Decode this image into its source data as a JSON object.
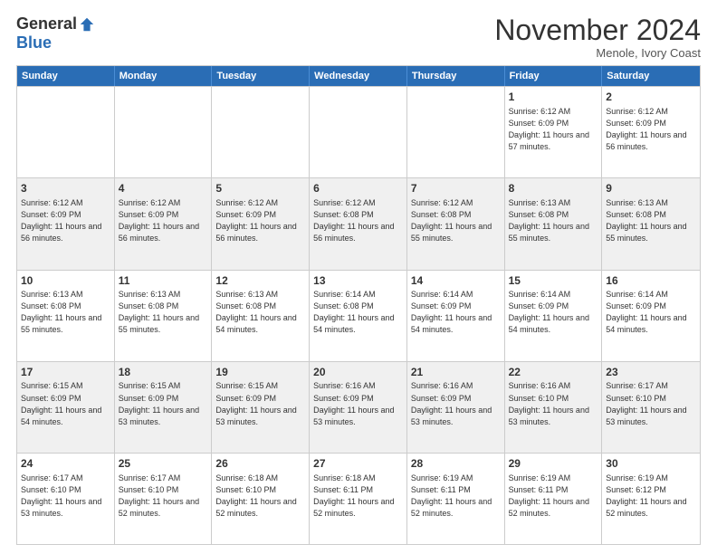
{
  "logo": {
    "general": "General",
    "blue": "Blue"
  },
  "header": {
    "month": "November 2024",
    "location": "Menole, Ivory Coast"
  },
  "days": [
    "Sunday",
    "Monday",
    "Tuesday",
    "Wednesday",
    "Thursday",
    "Friday",
    "Saturday"
  ],
  "weeks": [
    [
      {
        "day": "",
        "text": ""
      },
      {
        "day": "",
        "text": ""
      },
      {
        "day": "",
        "text": ""
      },
      {
        "day": "",
        "text": ""
      },
      {
        "day": "",
        "text": ""
      },
      {
        "day": "1",
        "text": "Sunrise: 6:12 AM\nSunset: 6:09 PM\nDaylight: 11 hours and 57 minutes."
      },
      {
        "day": "2",
        "text": "Sunrise: 6:12 AM\nSunset: 6:09 PM\nDaylight: 11 hours and 56 minutes."
      }
    ],
    [
      {
        "day": "3",
        "text": "Sunrise: 6:12 AM\nSunset: 6:09 PM\nDaylight: 11 hours and 56 minutes."
      },
      {
        "day": "4",
        "text": "Sunrise: 6:12 AM\nSunset: 6:09 PM\nDaylight: 11 hours and 56 minutes."
      },
      {
        "day": "5",
        "text": "Sunrise: 6:12 AM\nSunset: 6:09 PM\nDaylight: 11 hours and 56 minutes."
      },
      {
        "day": "6",
        "text": "Sunrise: 6:12 AM\nSunset: 6:08 PM\nDaylight: 11 hours and 56 minutes."
      },
      {
        "day": "7",
        "text": "Sunrise: 6:12 AM\nSunset: 6:08 PM\nDaylight: 11 hours and 55 minutes."
      },
      {
        "day": "8",
        "text": "Sunrise: 6:13 AM\nSunset: 6:08 PM\nDaylight: 11 hours and 55 minutes."
      },
      {
        "day": "9",
        "text": "Sunrise: 6:13 AM\nSunset: 6:08 PM\nDaylight: 11 hours and 55 minutes."
      }
    ],
    [
      {
        "day": "10",
        "text": "Sunrise: 6:13 AM\nSunset: 6:08 PM\nDaylight: 11 hours and 55 minutes."
      },
      {
        "day": "11",
        "text": "Sunrise: 6:13 AM\nSunset: 6:08 PM\nDaylight: 11 hours and 55 minutes."
      },
      {
        "day": "12",
        "text": "Sunrise: 6:13 AM\nSunset: 6:08 PM\nDaylight: 11 hours and 54 minutes."
      },
      {
        "day": "13",
        "text": "Sunrise: 6:14 AM\nSunset: 6:08 PM\nDaylight: 11 hours and 54 minutes."
      },
      {
        "day": "14",
        "text": "Sunrise: 6:14 AM\nSunset: 6:09 PM\nDaylight: 11 hours and 54 minutes."
      },
      {
        "day": "15",
        "text": "Sunrise: 6:14 AM\nSunset: 6:09 PM\nDaylight: 11 hours and 54 minutes."
      },
      {
        "day": "16",
        "text": "Sunrise: 6:14 AM\nSunset: 6:09 PM\nDaylight: 11 hours and 54 minutes."
      }
    ],
    [
      {
        "day": "17",
        "text": "Sunrise: 6:15 AM\nSunset: 6:09 PM\nDaylight: 11 hours and 54 minutes."
      },
      {
        "day": "18",
        "text": "Sunrise: 6:15 AM\nSunset: 6:09 PM\nDaylight: 11 hours and 53 minutes."
      },
      {
        "day": "19",
        "text": "Sunrise: 6:15 AM\nSunset: 6:09 PM\nDaylight: 11 hours and 53 minutes."
      },
      {
        "day": "20",
        "text": "Sunrise: 6:16 AM\nSunset: 6:09 PM\nDaylight: 11 hours and 53 minutes."
      },
      {
        "day": "21",
        "text": "Sunrise: 6:16 AM\nSunset: 6:09 PM\nDaylight: 11 hours and 53 minutes."
      },
      {
        "day": "22",
        "text": "Sunrise: 6:16 AM\nSunset: 6:10 PM\nDaylight: 11 hours and 53 minutes."
      },
      {
        "day": "23",
        "text": "Sunrise: 6:17 AM\nSunset: 6:10 PM\nDaylight: 11 hours and 53 minutes."
      }
    ],
    [
      {
        "day": "24",
        "text": "Sunrise: 6:17 AM\nSunset: 6:10 PM\nDaylight: 11 hours and 53 minutes."
      },
      {
        "day": "25",
        "text": "Sunrise: 6:17 AM\nSunset: 6:10 PM\nDaylight: 11 hours and 52 minutes."
      },
      {
        "day": "26",
        "text": "Sunrise: 6:18 AM\nSunset: 6:10 PM\nDaylight: 11 hours and 52 minutes."
      },
      {
        "day": "27",
        "text": "Sunrise: 6:18 AM\nSunset: 6:11 PM\nDaylight: 11 hours and 52 minutes."
      },
      {
        "day": "28",
        "text": "Sunrise: 6:19 AM\nSunset: 6:11 PM\nDaylight: 11 hours and 52 minutes."
      },
      {
        "day": "29",
        "text": "Sunrise: 6:19 AM\nSunset: 6:11 PM\nDaylight: 11 hours and 52 minutes."
      },
      {
        "day": "30",
        "text": "Sunrise: 6:19 AM\nSunset: 6:12 PM\nDaylight: 11 hours and 52 minutes."
      }
    ]
  ]
}
